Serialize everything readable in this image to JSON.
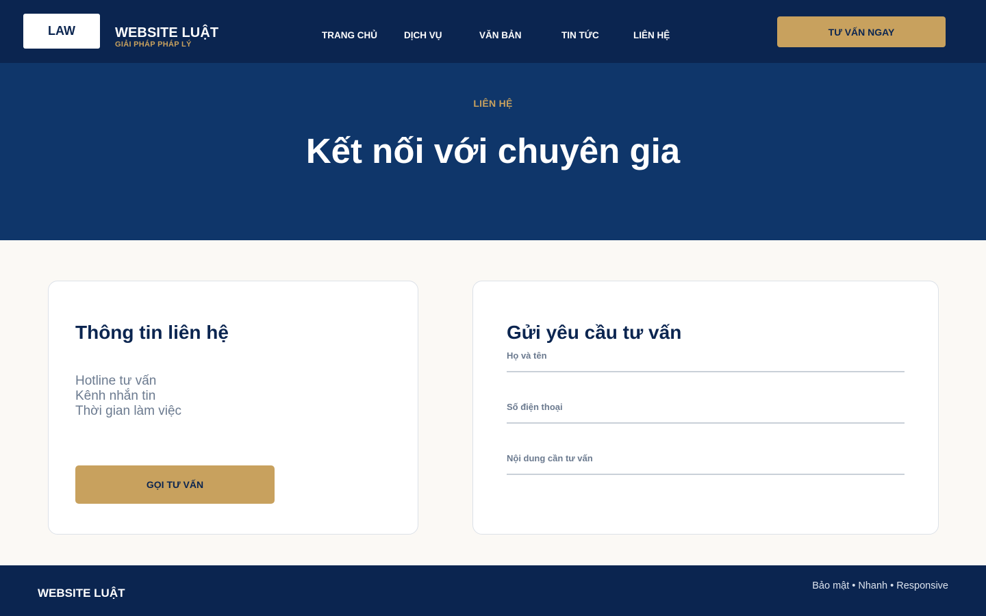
{
  "header": {
    "logo_text": "LAW",
    "brand_name": "WEBSITE LUẬT",
    "brand_tagline": "GIẢI PHÁP PHÁP LÝ",
    "nav": [
      {
        "label": "TRANG CHỦ"
      },
      {
        "label": "DỊCH VỤ"
      },
      {
        "label": "VĂN BẢN"
      },
      {
        "label": "TIN TỨC"
      },
      {
        "label": "LIÊN HỆ"
      }
    ],
    "cta_label": "TƯ VẤN NGAY"
  },
  "hero": {
    "eyebrow": "LIÊN HỆ",
    "title": "Kết nối với chuyên gia"
  },
  "contact_info": {
    "title": "Thông tin liên hệ",
    "items": [
      {
        "label": "Hotline tư vấn"
      },
      {
        "label": "Kênh nhắn tin"
      },
      {
        "label": "Thời gian làm việc"
      }
    ],
    "call_button_label": "GỌI TƯ VẤN"
  },
  "consult_form": {
    "title": "Gửi yêu cầu tư vấn",
    "fields": [
      {
        "label": "Họ và tên",
        "value": ""
      },
      {
        "label": "Số điện thoại",
        "value": ""
      },
      {
        "label": "Nội dung cần tư vấn",
        "value": ""
      }
    ]
  },
  "footer": {
    "brand": "WEBSITE LUẬT",
    "tagline": "Bảo mật • Nhanh • Responsive"
  },
  "colors": {
    "navy": "#0B2550",
    "hero_blue": "#0F366A",
    "gold": "#C8A15E",
    "page_bg": "#FBF9F5",
    "muted_text": "#6B7A8F"
  }
}
